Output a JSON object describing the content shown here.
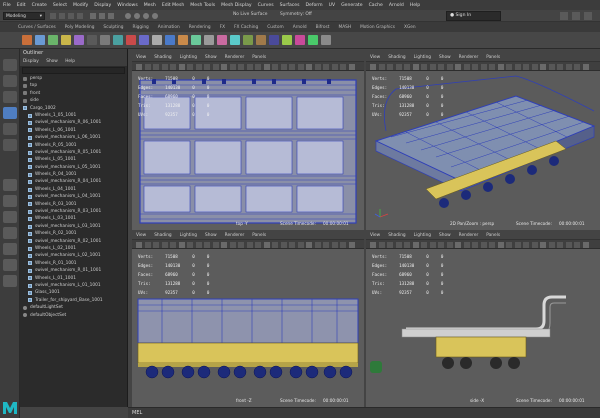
{
  "menu": [
    "File",
    "Edit",
    "Create",
    "Select",
    "Modify",
    "Display",
    "Windows",
    "Mesh",
    "Edit Mesh",
    "Mesh Tools",
    "Mesh Display",
    "Curves",
    "Surfaces",
    "Deform",
    "UV",
    "Generate",
    "Cache",
    "Arnold",
    "Help"
  ],
  "status": {
    "mode": "Modeling",
    "live_surface": "No Live Surface",
    "symmetry": "Symmetry: Off",
    "sign_in": "Sign In"
  },
  "shelf_tabs": [
    "Curves / Surfaces",
    "Poly Modeling",
    "Sculpting",
    "Rigging",
    "Animation",
    "Rendering",
    "FX",
    "FX Caching",
    "Custom",
    "Arnold",
    "Bifrost",
    "MASH",
    "Motion Graphics",
    "XGen"
  ],
  "outliner": {
    "title": "Outliner",
    "menu": [
      "Display",
      "Show",
      "Help"
    ],
    "items": [
      {
        "label": "persp",
        "icon": "camera-icon"
      },
      {
        "label": "top",
        "icon": "camera-icon"
      },
      {
        "label": "front",
        "icon": "camera-icon"
      },
      {
        "label": "side",
        "icon": "camera-icon"
      },
      {
        "label": "Cargo_1002",
        "icon": "mesh-icon"
      },
      {
        "label": "Wheels_1_05_1001",
        "icon": "mesh-icon"
      },
      {
        "label": "swivel_mechanism_R_06_1001",
        "icon": "mesh-icon"
      },
      {
        "label": "Wheels_L_06_1001",
        "icon": "mesh-icon"
      },
      {
        "label": "swivel_mechanism_L_06_1001",
        "icon": "mesh-icon"
      },
      {
        "label": "Wheels_R_05_1001",
        "icon": "mesh-icon"
      },
      {
        "label": "swivel_mechanism_R_05_1001",
        "icon": "mesh-icon"
      },
      {
        "label": "Wheels_L_05_1001",
        "icon": "mesh-icon"
      },
      {
        "label": "swivel_mechanism_L_05_1001",
        "icon": "mesh-icon"
      },
      {
        "label": "Wheels_R_04_1001",
        "icon": "mesh-icon"
      },
      {
        "label": "swivel_mechanism_R_04_1001",
        "icon": "mesh-icon"
      },
      {
        "label": "Wheels_L_04_1001",
        "icon": "mesh-icon"
      },
      {
        "label": "swivel_mechanism_L_04_1001",
        "icon": "mesh-icon"
      },
      {
        "label": "Wheels_R_03_1001",
        "icon": "mesh-icon"
      },
      {
        "label": "swivel_mechanism_R_03_1001",
        "icon": "mesh-icon"
      },
      {
        "label": "Wheels_L_03_1001",
        "icon": "mesh-icon"
      },
      {
        "label": "swivel_mechanism_L_03_1001",
        "icon": "mesh-icon"
      },
      {
        "label": "Wheels_R_02_1001",
        "icon": "mesh-icon"
      },
      {
        "label": "swivel_mechanism_R_02_1001",
        "icon": "mesh-icon"
      },
      {
        "label": "Wheels_L_02_1001",
        "icon": "mesh-icon"
      },
      {
        "label": "swivel_mechanism_L_02_1001",
        "icon": "mesh-icon"
      },
      {
        "label": "Wheels_R_01_1001",
        "icon": "mesh-icon"
      },
      {
        "label": "swivel_mechanism_R_01_1001",
        "icon": "mesh-icon"
      },
      {
        "label": "Wheels_L_01_1001",
        "icon": "mesh-icon"
      },
      {
        "label": "swivel_mechanism_L_01_1001",
        "icon": "mesh-icon"
      },
      {
        "label": "Glass_1001",
        "icon": "mesh-icon"
      },
      {
        "label": "Trailer_for_shipyard_Base_1001",
        "icon": "mesh-icon"
      },
      {
        "label": "defaultLightSet",
        "icon": "set-icon"
      },
      {
        "label": "defaultObjectSet",
        "icon": "set-icon"
      }
    ]
  },
  "viewport_menu": [
    "View",
    "Shading",
    "Lighting",
    "Show",
    "Renderer",
    "Panels"
  ],
  "viewports": [
    {
      "id": "top",
      "stats": [
        [
          "Verts:",
          "71508",
          "0",
          "0"
        ],
        [
          "Edges:",
          "140130",
          "0",
          "0"
        ],
        [
          "Faces:",
          "68960",
          "0",
          "0"
        ],
        [
          "Tris:",
          "131288",
          "0",
          "0"
        ],
        [
          "UVs:",
          "92357",
          "0",
          "0"
        ]
      ],
      "camera": "top -Y",
      "timecode_label": "Scene Timecode:",
      "timecode": "00:00:00:01"
    },
    {
      "id": "persp",
      "stats": [
        [
          "Verts:",
          "71508",
          "0",
          "0"
        ],
        [
          "Edges:",
          "140130",
          "0",
          "0"
        ],
        [
          "Faces:",
          "68960",
          "0",
          "0"
        ],
        [
          "Tris:",
          "131288",
          "0",
          "0"
        ],
        [
          "UVs:",
          "92357",
          "0",
          "0"
        ]
      ],
      "camera": "2D Pan/Zoom : persp",
      "timecode_label": "Scene Timecode:",
      "timecode": "00:00:00:01"
    },
    {
      "id": "front",
      "stats": [
        [
          "Verts:",
          "71508",
          "0",
          "0"
        ],
        [
          "Edges:",
          "140130",
          "0",
          "0"
        ],
        [
          "Faces:",
          "68960",
          "0",
          "0"
        ],
        [
          "Tris:",
          "131288",
          "0",
          "0"
        ],
        [
          "UVs:",
          "92357",
          "0",
          "0"
        ]
      ],
      "camera": "front -Z",
      "timecode_label": "Scene Timecode:",
      "timecode": "00:00:00:01"
    },
    {
      "id": "side",
      "stats": [
        [
          "Verts:",
          "71508",
          "0",
          "0"
        ],
        [
          "Edges:",
          "140130",
          "0",
          "0"
        ],
        [
          "Faces:",
          "68960",
          "0",
          "0"
        ],
        [
          "Tris:",
          "131288",
          "0",
          "0"
        ],
        [
          "UVs:",
          "92357",
          "0",
          "0"
        ]
      ],
      "camera": "side -X",
      "timecode_label": "Scene Timecode:",
      "timecode": "00:00:00:01"
    }
  ],
  "cmdline": {
    "label": "MEL"
  },
  "colors": {
    "accent_blue": "#3a5fbf",
    "wire_blue": "#2f3fb8",
    "model_yellow": "#d9c45a",
    "maya_teal": "#1fb8c4"
  }
}
